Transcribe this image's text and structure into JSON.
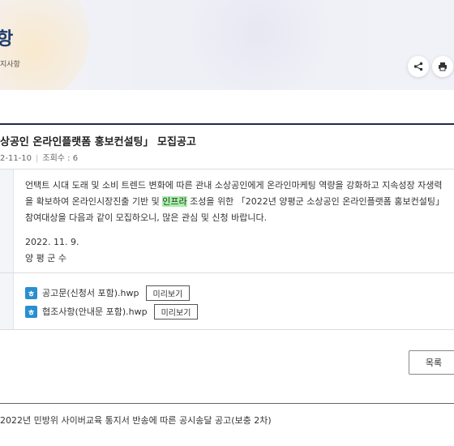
{
  "header": {
    "title": "항",
    "breadcrumb": "지사항"
  },
  "post": {
    "title": "상공인 온라인플랫폼 홍보컨설팅」 모집공고",
    "date": "2-11-10",
    "views": "조회수 : 6",
    "body_before": "언택트 시대 도래 및 소비 트렌드 변화에 따른 관내 소상공인에게 온라인마케팅 역량을 강화하고 지속성장 자생력을 확보하여 온라인시장진출 기반 및 ",
    "body_highlight": "인프라",
    "body_after": " 조성을 위한 「2022년 양평군 소상공인 온라인플랫폼 홍보컨설팅」 참여대상을 다음과 같이 모집하오니, 많은 관심 및 신청 바랍니다.",
    "sign_date": "2022. 11. 9.",
    "signer": "양 평 군 수"
  },
  "attachments": [
    {
      "name": "공고문(신청서 포함).hwp",
      "preview_label": "미리보기",
      "icon": "hwp-file-icon"
    },
    {
      "name": "협조사항(안내문 포함).hwp",
      "preview_label": "미리보기",
      "icon": "hwp-file-icon"
    }
  ],
  "list_button": "목록",
  "next_post": "2022년 민방위 사이버교육 통지서 반송에 따른 공시송달 공고(보충 2차)",
  "colors": {
    "title": "#1f3b70",
    "highlight": "#a7f0a7",
    "hwp_icon": "#2a8fd0",
    "rule": "#1f2b4f"
  }
}
